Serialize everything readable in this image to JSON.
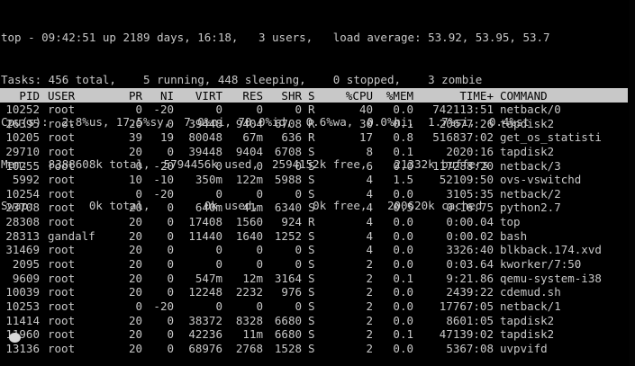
{
  "summary": {
    "line1": "top - 09:42:51 up 2189 days, 16:18,   3 users,   load average: 53.92, 53.95, 53.7",
    "line2": "Tasks: 456 total,    5 running, 448 sleeping,    0 stopped,    3 zombie",
    "line3": "Cpu(s):  2.8%us, 17.5%sy,  7.0%ni, 70.0%id,  0.6%wa,  0.0%hi,  1.7%si,  0.4%st",
    "line4": "Mem:   8388608k total,  5794456k used,  2594152k free,    21332k buffers",
    "line5": "Swap:        0k total,        0k used,        0k free,   200620k cached"
  },
  "columns": {
    "pid": "PID",
    "user": "USER",
    "pr": "PR",
    "ni": "NI",
    "virt": "VIRT",
    "res": "RES",
    "shr": "SHR",
    "s": "S",
    "cpu": "%CPU",
    "mem": "%MEM",
    "time": "TIME+",
    "command": "COMMAND"
  },
  "processes": [
    {
      "pid": "10252",
      "user": "root",
      "pr": "0",
      "ni": "-20",
      "virt": "0",
      "res": "0",
      "shr": "0",
      "s": "R",
      "cpu": "40",
      "mem": "0.0",
      "time": "742113:51",
      "command": "netback/0"
    },
    {
      "pid": "26395",
      "user": "root",
      "pr": "20",
      "ni": "0",
      "virt": "39448",
      "res": "9404",
      "shr": "6708",
      "s": "R",
      "cpu": "30",
      "mem": "0.1",
      "time": "20677:26",
      "command": "tapdisk2"
    },
    {
      "pid": "10205",
      "user": "root",
      "pr": "39",
      "ni": "19",
      "virt": "80048",
      "res": "67m",
      "shr": "636",
      "s": "R",
      "cpu": "17",
      "mem": "0.8",
      "time": "516837:02",
      "command": "get_os_statisti"
    },
    {
      "pid": "29710",
      "user": "root",
      "pr": "20",
      "ni": "0",
      "virt": "39448",
      "res": "9404",
      "shr": "6708",
      "s": "S",
      "cpu": "8",
      "mem": "0.1",
      "time": "2020:16",
      "command": "tapdisk2"
    },
    {
      "pid": "10255",
      "user": "root",
      "pr": "0",
      "ni": "-20",
      "virt": "0",
      "res": "0",
      "shr": "0",
      "s": "S",
      "cpu": "6",
      "mem": "0.0",
      "time": "117288:20",
      "command": "netback/3"
    },
    {
      "pid": "5992",
      "user": "root",
      "pr": "10",
      "ni": "-10",
      "virt": "350m",
      "res": "122m",
      "shr": "5988",
      "s": "S",
      "cpu": "4",
      "mem": "1.5",
      "time": "52109:50",
      "command": "ovs-vswitchd"
    },
    {
      "pid": "10254",
      "user": "root",
      "pr": "0",
      "ni": "-20",
      "virt": "0",
      "res": "0",
      "shr": "0",
      "s": "S",
      "cpu": "4",
      "mem": "0.0",
      "time": "3105:35",
      "command": "netback/2"
    },
    {
      "pid": "23708",
      "user": "root",
      "pr": "20",
      "ni": "0",
      "virt": "640m",
      "res": "41m",
      "shr": "6340",
      "s": "S",
      "cpu": "4",
      "mem": "0.5",
      "time": "0:16.75",
      "command": "python2.7"
    },
    {
      "pid": "28308",
      "user": "root",
      "pr": "20",
      "ni": "0",
      "virt": "17408",
      "res": "1560",
      "shr": "924",
      "s": "R",
      "cpu": "4",
      "mem": "0.0",
      "time": "0:00.04",
      "command": "top"
    },
    {
      "pid": "28313",
      "user": "gandalf",
      "pr": "20",
      "ni": "0",
      "virt": "11440",
      "res": "1640",
      "shr": "1252",
      "s": "S",
      "cpu": "4",
      "mem": "0.0",
      "time": "0:00.02",
      "command": "bash"
    },
    {
      "pid": "31469",
      "user": "root",
      "pr": "20",
      "ni": "0",
      "virt": "0",
      "res": "0",
      "shr": "0",
      "s": "S",
      "cpu": "4",
      "mem": "0.0",
      "time": "3326:40",
      "command": "blkback.174.xvd"
    },
    {
      "pid": "2095",
      "user": "root",
      "pr": "20",
      "ni": "0",
      "virt": "0",
      "res": "0",
      "shr": "0",
      "s": "S",
      "cpu": "2",
      "mem": "0.0",
      "time": "0:03.64",
      "command": "kworker/7:50"
    },
    {
      "pid": "9609",
      "user": "root",
      "pr": "20",
      "ni": "0",
      "virt": "547m",
      "res": "12m",
      "shr": "3164",
      "s": "S",
      "cpu": "2",
      "mem": "0.1",
      "time": "9:21.86",
      "command": "qemu-system-i38"
    },
    {
      "pid": "10039",
      "user": "root",
      "pr": "20",
      "ni": "0",
      "virt": "12248",
      "res": "2232",
      "shr": "976",
      "s": "S",
      "cpu": "2",
      "mem": "0.0",
      "time": "2439:22",
      "command": "cdemud.sh"
    },
    {
      "pid": "10253",
      "user": "root",
      "pr": "0",
      "ni": "-20",
      "virt": "0",
      "res": "0",
      "shr": "0",
      "s": "S",
      "cpu": "2",
      "mem": "0.0",
      "time": "17767:05",
      "command": "netback/1"
    },
    {
      "pid": "11414",
      "user": "root",
      "pr": "20",
      "ni": "0",
      "virt": "38372",
      "res": "8328",
      "shr": "6680",
      "s": "S",
      "cpu": "2",
      "mem": "0.0",
      "time": "8601:05",
      "command": "tapdisk2"
    },
    {
      "pid": "11960",
      "user": "root",
      "pr": "20",
      "ni": "0",
      "virt": "42236",
      "res": "11m",
      "shr": "6680",
      "s": "S",
      "cpu": "2",
      "mem": "0.1",
      "time": "47139:02",
      "command": "tapdisk2"
    },
    {
      "pid": "13136",
      "user": "root",
      "pr": "20",
      "ni": "0",
      "virt": "68976",
      "res": "2768",
      "shr": "1528",
      "s": "S",
      "cpu": "2",
      "mem": "0.0",
      "time": "5367:08",
      "command": "uvpvifd"
    }
  ]
}
